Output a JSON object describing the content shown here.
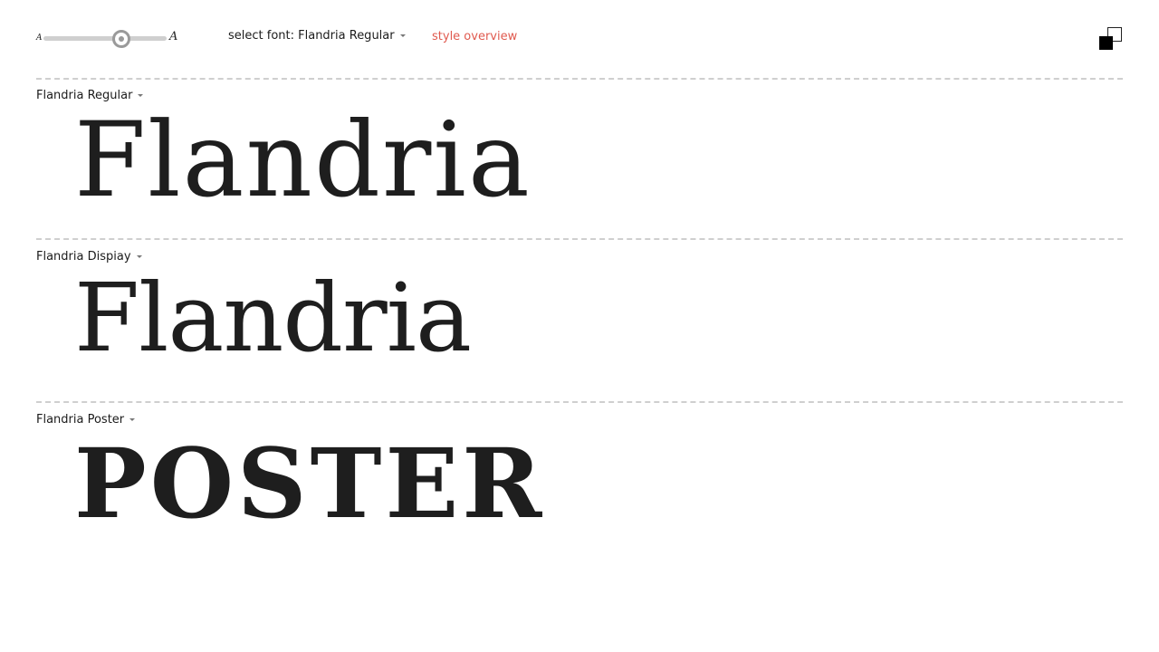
{
  "toolbar": {
    "size_small_glyph": "A",
    "size_large_glyph": "A",
    "size_level_percent": 63,
    "font_select_label": "select font: Flandria Regular",
    "style_overview_label": "style overview"
  },
  "specimens": [
    {
      "label": "Flandria Regular",
      "sample": "Flandria"
    },
    {
      "label": "Flandria Dispiay",
      "sample": "Flandria"
    },
    {
      "label": "Flandria Poster",
      "sample": "POSTER"
    }
  ],
  "colors": {
    "accent": "#e05a4f",
    "text": "#1b1b1b",
    "divider": "#cfcfcf"
  }
}
